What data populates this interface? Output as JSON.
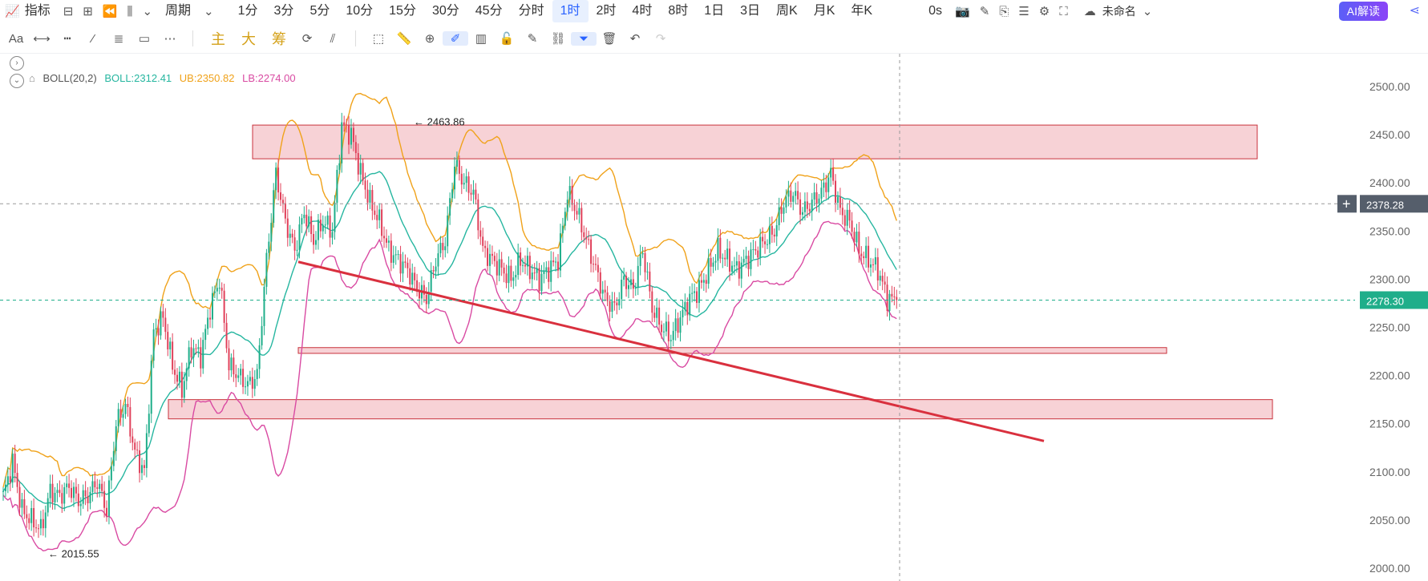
{
  "toolbar": {
    "indicator_label": "指标",
    "period_label": "周期",
    "periods": [
      "1分",
      "3分",
      "5分",
      "10分",
      "15分",
      "30分",
      "45分",
      "分时",
      "1时",
      "2时",
      "4时",
      "8时",
      "1日",
      "3日",
      "周K",
      "月K",
      "年K"
    ],
    "active_period": "1时",
    "latency": "0s",
    "layout_name": "未命名",
    "ai_label": "AI解读"
  },
  "drawing_tools": {
    "text_tool": "Aa",
    "labels": [
      "主",
      "大",
      "筹"
    ]
  },
  "indicator": {
    "name": "BOLL(20,2)",
    "boll_label": "BOLL:2312.41",
    "ub_label": "UB:2350.82",
    "lb_label": "LB:2274.00"
  },
  "colors": {
    "up": "#1fae8a",
    "down": "#e0405a",
    "mid": "#26b6a0",
    "upper": "#f0a21a",
    "lower": "#d94aa2",
    "zone_fill": "#f7d2d6",
    "zone_stroke": "#c8323c",
    "trend": "#d9303e",
    "last_price_bg": "#1fae8a",
    "crosshair_bg": "#555e6b"
  },
  "chart_data": {
    "type": "candlestick",
    "title": "",
    "ylim": [
      1990,
      2520
    ],
    "y_ticks": [
      2000,
      2050,
      2100,
      2150,
      2200,
      2250,
      2300,
      2350,
      2400,
      2450,
      2500
    ],
    "y_tick_labels": [
      "2000.00",
      "2050.00",
      "2100.00",
      "2150.00",
      "2200.00",
      "2250.00",
      "2300.00",
      "2350.00",
      "2400.00",
      "2450.00",
      "2500.00"
    ],
    "annotations": {
      "high": {
        "value": 2463.86,
        "label": "2463.86"
      },
      "low": {
        "value": 2015.55,
        "label": "2015.55"
      }
    },
    "last_price": {
      "value": 2278.3,
      "label": "2278.30"
    },
    "crosshair_price": {
      "value": 2378.28,
      "label": "2378.28"
    },
    "resistance_zones": [
      {
        "from": 2425,
        "to": 2460
      },
      {
        "from": 2223,
        "to": 2229
      },
      {
        "from": 2155,
        "to": 2175
      }
    ],
    "trendline": {
      "from_value": 2318,
      "to_value": 2132
    },
    "close_path": [
      2075,
      2110,
      2060,
      2050,
      2040,
      2080,
      2075,
      2085,
      2070,
      2075,
      2090,
      2060,
      2150,
      2170,
      2120,
      2100,
      2245,
      2260,
      2210,
      2185,
      2230,
      2220,
      2270,
      2300,
      2210,
      2200,
      2190,
      2200,
      2320,
      2410,
      2360,
      2330,
      2370,
      2340,
      2360,
      2350,
      2460,
      2450,
      2410,
      2380,
      2360,
      2330,
      2320,
      2310,
      2290,
      2280,
      2320,
      2340,
      2420,
      2400,
      2390,
      2330,
      2320,
      2310,
      2300,
      2320,
      2310,
      2300,
      2310,
      2320,
      2390,
      2370,
      2340,
      2310,
      2280,
      2270,
      2300,
      2290,
      2330,
      2270,
      2250,
      2240,
      2260,
      2280,
      2290,
      2310,
      2330,
      2320,
      2310,
      2320,
      2330,
      2340,
      2350,
      2380,
      2390,
      2370,
      2380,
      2390,
      2410,
      2370,
      2360,
      2330,
      2320,
      2310,
      2280,
      2278.3
    ]
  }
}
